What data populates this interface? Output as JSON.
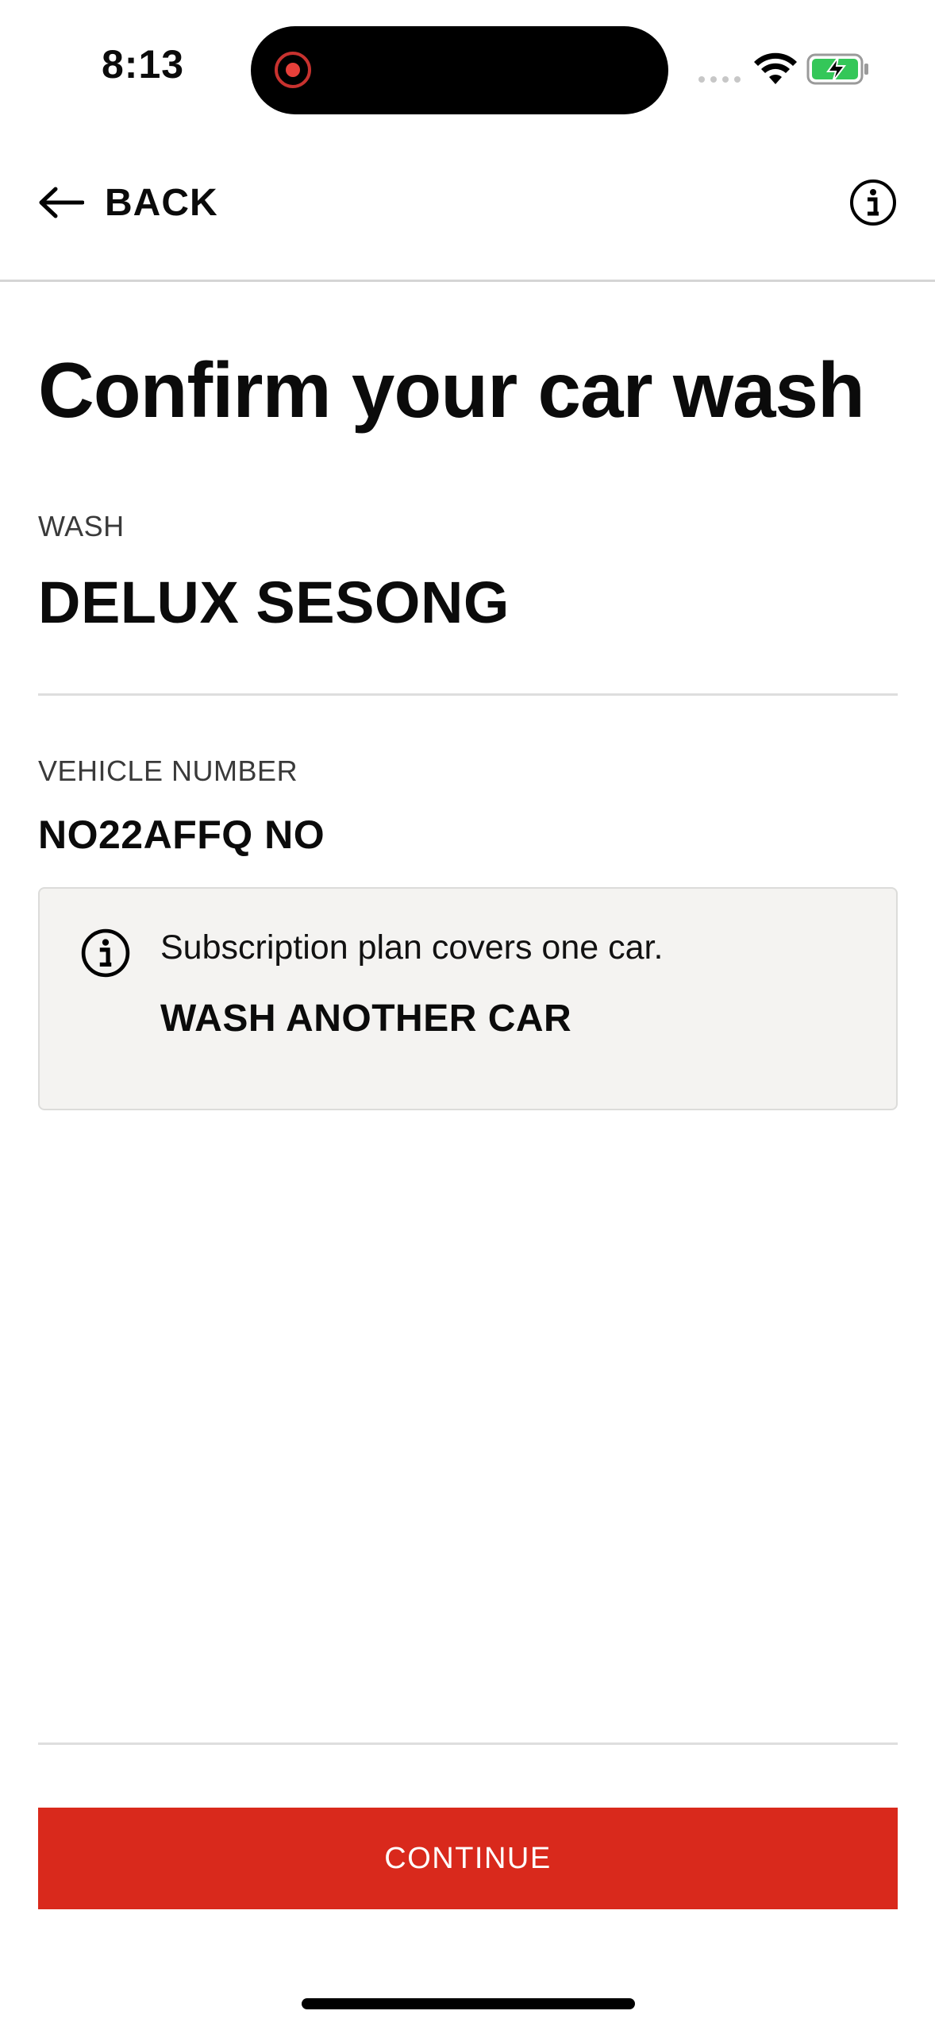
{
  "status_bar": {
    "time": "8:13",
    "icons": [
      "recording-icon",
      "cellular-signal-icon",
      "wifi-icon",
      "battery-charging-icon"
    ],
    "battery_color": "#34c759",
    "recording_color": "#e8403a"
  },
  "header": {
    "back_label": "BACK",
    "back_icon": "arrow-left-icon",
    "info_icon": "info-circle-icon"
  },
  "main": {
    "title": "Confirm your car wash",
    "wash": {
      "label": "WASH",
      "value": "DELUX SESONG"
    },
    "vehicle": {
      "label": "VEHICLE NUMBER",
      "value": "NO22AFFQ NO"
    },
    "notice": {
      "icon": "info-circle-icon",
      "text": "Subscription plan covers one car.",
      "link_label": "WASH ANOTHER CAR"
    }
  },
  "footer": {
    "continue_label": "CONTINUE",
    "accent_color": "#d9291c"
  }
}
